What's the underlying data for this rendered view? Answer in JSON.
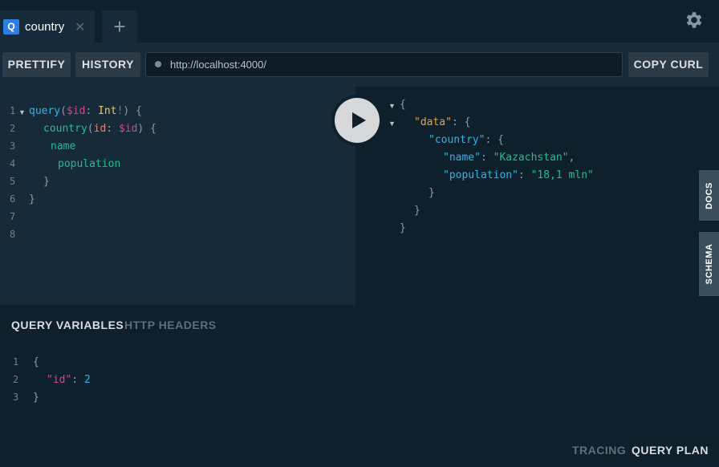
{
  "tabs": [
    {
      "badge": "Q",
      "label": "country",
      "close": "✕"
    }
  ],
  "add_tab": "+",
  "toolbar": {
    "prettify": "PRETTIFY",
    "history": "HISTORY",
    "url": "http://localhost:4000/",
    "copy_curl": "COPY CURL"
  },
  "editor": {
    "line_numbers": [
      "1",
      "2",
      "3",
      "4",
      "5",
      "6",
      "7",
      "8"
    ],
    "tokens": {
      "query": "query",
      "paren_open": "(",
      "var_id": "$id",
      "colon": ":",
      "type_int": "Int",
      "bang": "!",
      "paren_close_brace": ") {",
      "country": "country",
      "paren": "(",
      "arg_id": "id",
      "colon2": ":",
      "var_id2": "$id",
      "close_brace_open": ") {",
      "name": "name",
      "population": "population",
      "brace_close": "}",
      "brace_close2": "}"
    }
  },
  "variables": {
    "tabs": {
      "query_variables": "QUERY VARIABLES",
      "http_headers": "HTTP HEADERS"
    },
    "line_numbers": [
      "1",
      "2",
      "3"
    ],
    "open": "{",
    "key": "\"id\"",
    "colon": ":",
    "value": "2",
    "close": "}"
  },
  "result": {
    "open": "{",
    "data_key": "\"data\"",
    "colon": ":",
    "brace": "{",
    "country_key": "\"country\"",
    "name_key": "\"name\"",
    "name_value": "\"Kazachstan\"",
    "comma": ",",
    "population_key": "\"population\"",
    "population_value": "\"18,1 mln\"",
    "close1": "}",
    "close2": "}",
    "close3": "}"
  },
  "side_tabs": {
    "docs": "DOCS",
    "schema": "SCHEMA"
  },
  "footer": {
    "tracing": "TRACING",
    "query_plan": "QUERY PLAN"
  },
  "colors": {
    "accent": "#2e7de0",
    "bg": "#172a3a",
    "panel": "#0f202d"
  }
}
